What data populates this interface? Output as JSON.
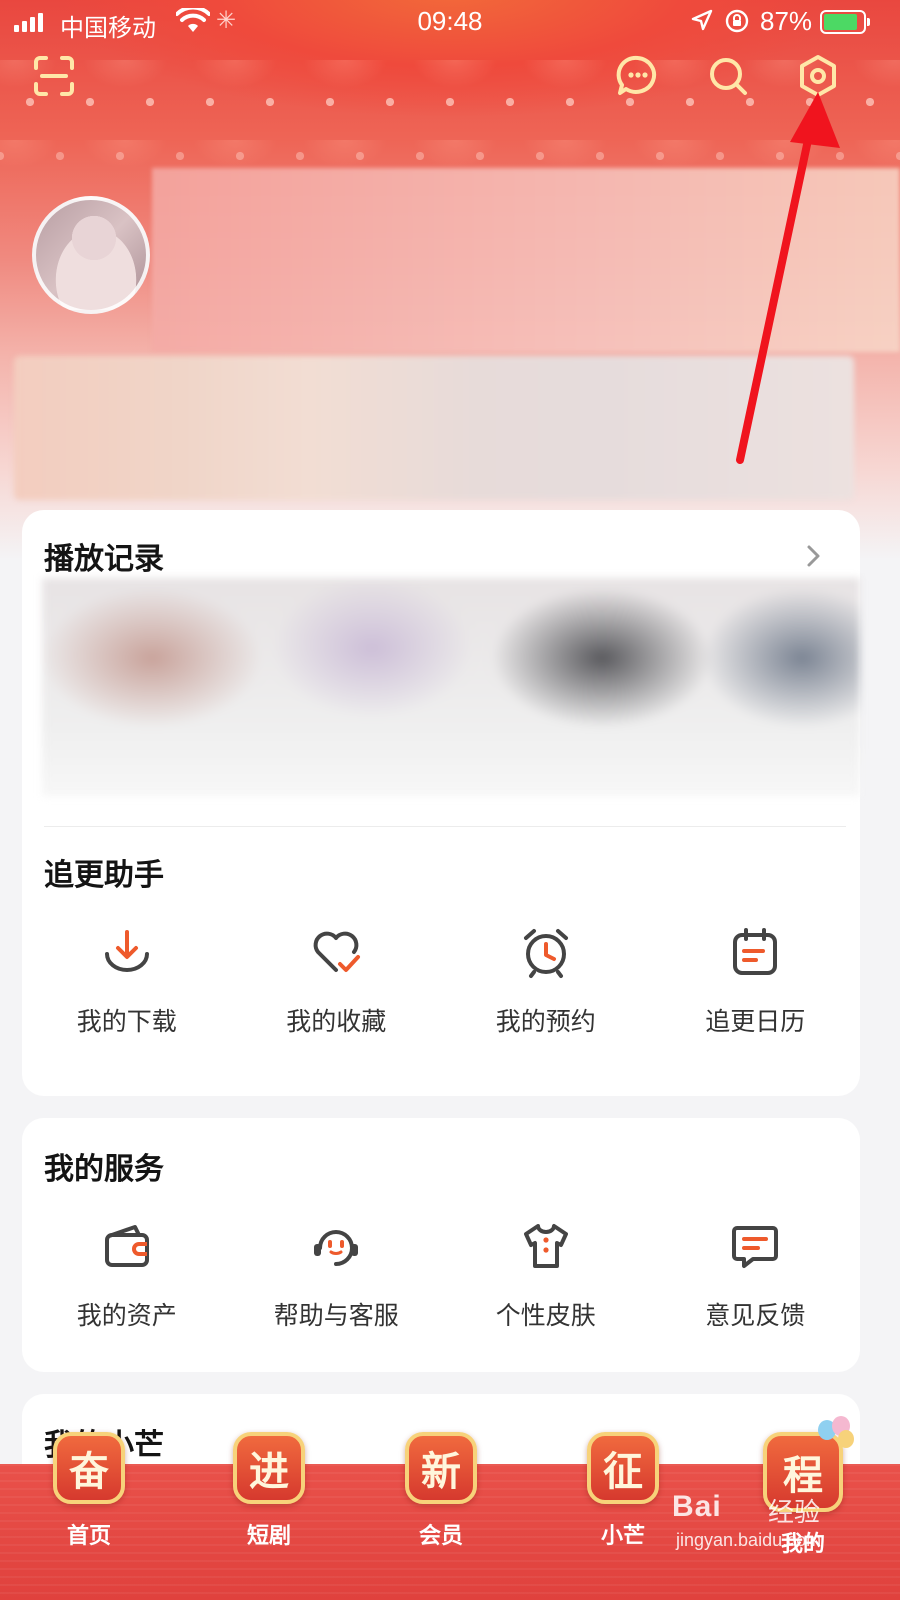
{
  "status_bar": {
    "carrier": "中国移动",
    "time": "09:48",
    "battery_text": "87%",
    "battery_level": 0.87
  },
  "top_bar": {
    "icons": [
      "scan-icon",
      "message-icon",
      "search-icon",
      "settings-icon"
    ]
  },
  "history": {
    "title": "播放记录"
  },
  "tracker": {
    "title": "追更助手",
    "items": [
      {
        "label": "我的下载",
        "icon": "download-icon"
      },
      {
        "label": "我的收藏",
        "icon": "heart-check-icon"
      },
      {
        "label": "我的预约",
        "icon": "alarm-clock-icon"
      },
      {
        "label": "追更日历",
        "icon": "calendar-icon"
      }
    ]
  },
  "services": {
    "title": "我的服务",
    "items": [
      {
        "label": "我的资产",
        "icon": "wallet-icon"
      },
      {
        "label": "帮助与客服",
        "icon": "headset-icon"
      },
      {
        "label": "个性皮肤",
        "icon": "tshirt-icon"
      },
      {
        "label": "意见反馈",
        "icon": "feedback-icon"
      }
    ]
  },
  "xiaomang": {
    "title": "我的小芒"
  },
  "bottom_nav": [
    {
      "badge": "奋",
      "label": "首页"
    },
    {
      "badge": "进",
      "label": "短剧"
    },
    {
      "badge": "新",
      "label": "会员"
    },
    {
      "badge": "征",
      "label": "小芒"
    },
    {
      "badge": "程",
      "label": "我的"
    }
  ],
  "watermark": {
    "brand": "Bai",
    "jingyan": "经验",
    "url": "jingyan.baidu.com"
  },
  "colors": {
    "accent": "#ee5a2c",
    "icon_gray": "#444444",
    "annotation": "#f0141e",
    "nav_red": "#e0413d",
    "badge_border": "#f7d27a"
  }
}
